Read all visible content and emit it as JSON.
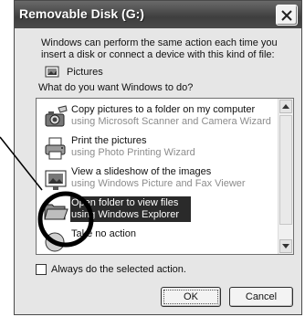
{
  "window": {
    "title": "Removable Disk (G:)",
    "close_glyph": "✕"
  },
  "dialog": {
    "description": "Windows can perform the same action each time you insert a disk or connect a device with this kind of file:",
    "content_type": "Pictures",
    "prompt": "What do you want Windows to do?"
  },
  "actions": [
    {
      "icon": "scanner-camera-icon",
      "title": "Copy pictures to a folder on my computer",
      "subtitle": "using Microsoft Scanner and Camera Wizard"
    },
    {
      "icon": "printer-icon",
      "title": "Print the pictures",
      "subtitle": "using Photo Printing Wizard"
    },
    {
      "icon": "slideshow-icon",
      "title": "View a slideshow of the images",
      "subtitle": "using Windows Picture and Fax Viewer"
    },
    {
      "icon": "folder-icon",
      "title": "Open folder to view files",
      "subtitle": "using Windows Explorer",
      "selected": true
    },
    {
      "icon": "action-icon",
      "title": "Take no action",
      "subtitle": ""
    }
  ],
  "checkbox": {
    "label": "Always do the selected action.",
    "checked": false
  },
  "buttons": {
    "ok": "OK",
    "cancel": "Cancel"
  },
  "colors": {
    "selection": "#2a2a2a",
    "titlebar": "#4a4a4a",
    "dialog_bg": "#e6e6e6",
    "annotation": "#000000"
  }
}
